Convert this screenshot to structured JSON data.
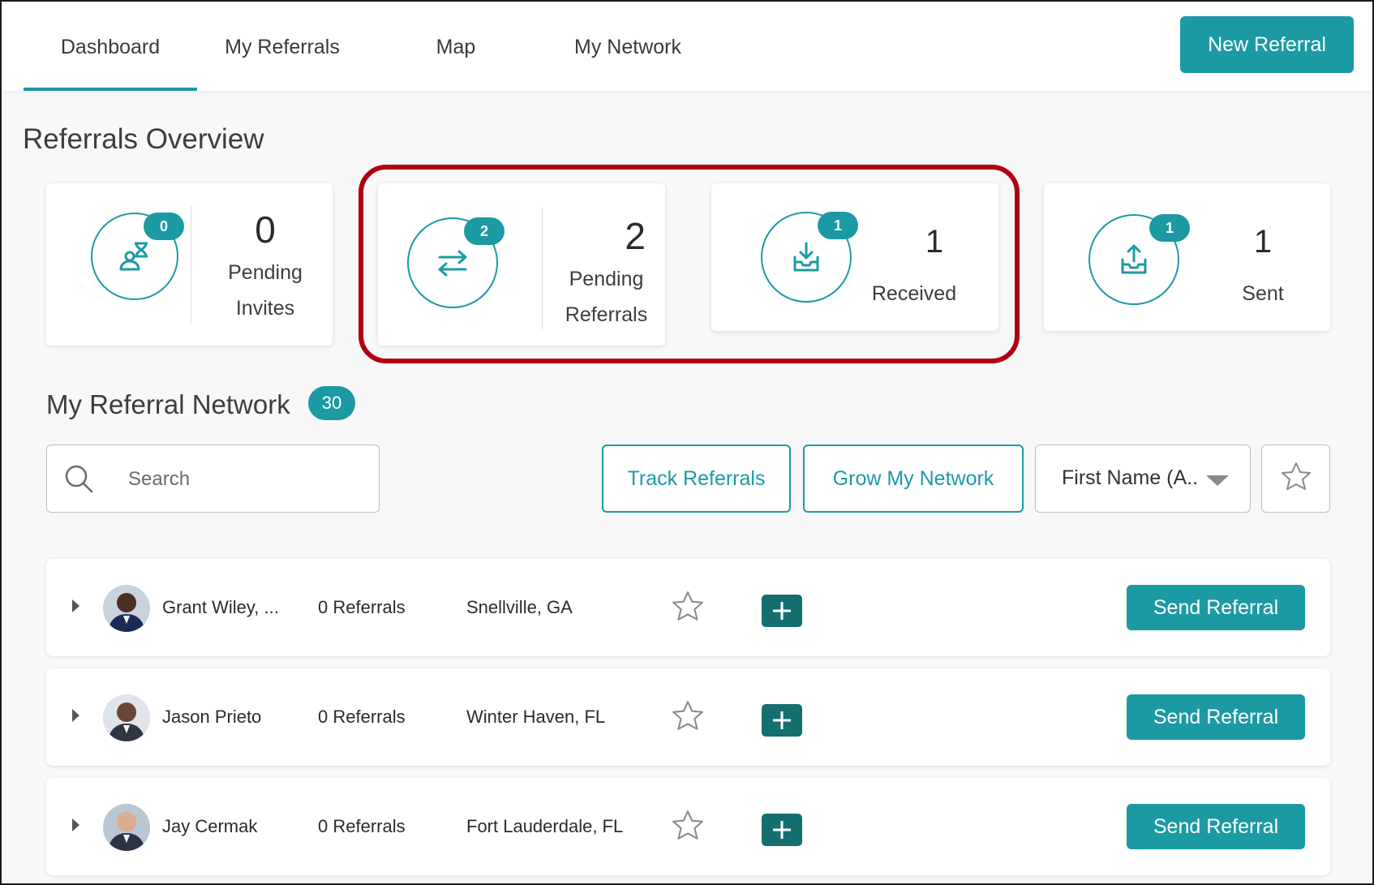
{
  "nav": {
    "tabs": [
      {
        "label": "Dashboard",
        "active": true
      },
      {
        "label": "My Referrals",
        "active": false
      },
      {
        "label": "Map",
        "active": false
      },
      {
        "label": "My Network",
        "active": false
      }
    ],
    "new_referral_label": "New Referral"
  },
  "overview": {
    "title": "Referrals Overview",
    "cards": [
      {
        "icon": "hourglass-person-icon",
        "badge": "0",
        "value": "0",
        "label_line1": "Pending",
        "label_line2": "Invites"
      },
      {
        "icon": "swap-arrows-icon",
        "badge": "2",
        "value": "2",
        "label_line1": "Pending",
        "label_line2": "Referrals"
      },
      {
        "icon": "inbox-download-icon",
        "badge": "1",
        "value": "1",
        "label_line1": "Received",
        "label_line2": ""
      },
      {
        "icon": "inbox-upload-icon",
        "badge": "1",
        "value": "1",
        "label_line1": "Sent",
        "label_line2": ""
      }
    ],
    "highlight_color": "#b0000f"
  },
  "network": {
    "title": "My Referral Network",
    "count": "30",
    "search_placeholder": "Search",
    "track_label": "Track Referrals",
    "grow_label": "Grow My Network",
    "sort_value": "First Name (A...",
    "rows": [
      {
        "name": "Grant Wiley, ...",
        "referrals": "0 Referrals",
        "location": "Snellville, GA",
        "send_label": "Send Referral"
      },
      {
        "name": "Jason Prieto",
        "referrals": "0 Referrals",
        "location": "Winter Haven, FL",
        "send_label": "Send Referral"
      },
      {
        "name": "Jay Cermak",
        "referrals": "0 Referrals",
        "location": "Fort Lauderdale, FL",
        "send_label": "Send Referral"
      }
    ]
  },
  "colors": {
    "accent": "#1c9aa3",
    "accent_dark": "#156f6f"
  }
}
